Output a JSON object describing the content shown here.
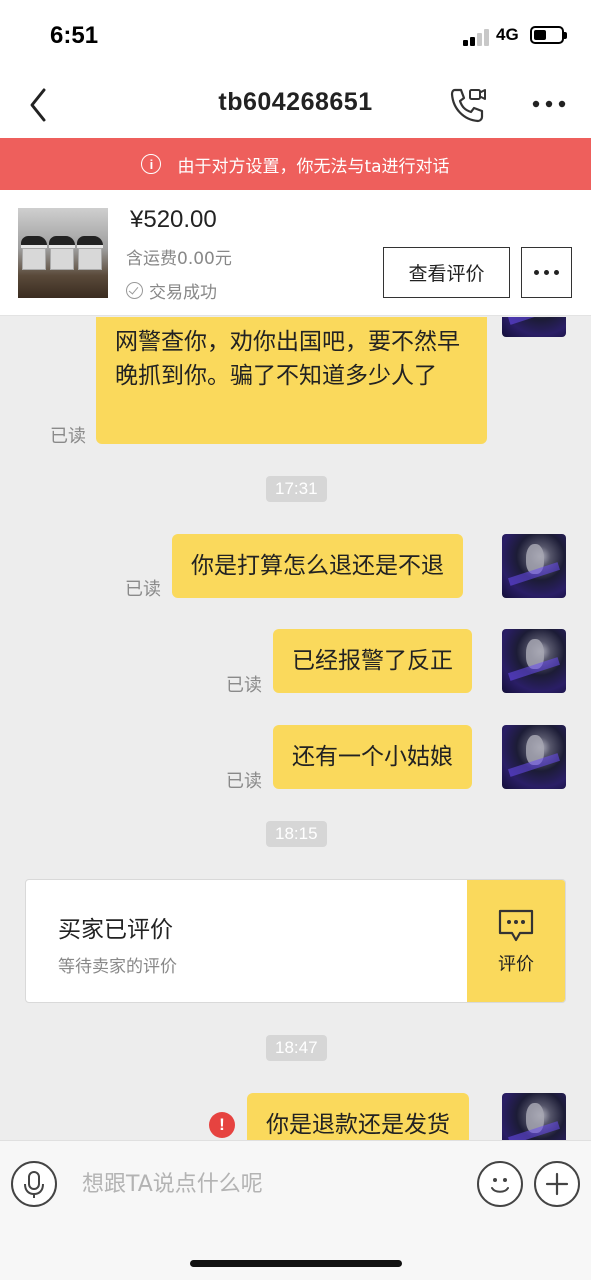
{
  "status_bar": {
    "time": "6:51",
    "network": "4G"
  },
  "nav": {
    "title": "tb604268651",
    "icons": {
      "back": "chevron-left-icon",
      "call": "phone-video-icon",
      "more": "more-dots-icon"
    }
  },
  "banner": {
    "icon": "info-icon",
    "text": "由于对方设置，你无法与ta进行对话"
  },
  "product": {
    "price": "¥520.00",
    "shipping": "含运费0.00元",
    "status": "交易成功",
    "review_button": "查看评价"
  },
  "messages": [
    {
      "text": "网警查你，劝你出国吧，要不然早晚抓到你。骗了不知道多少人了",
      "read": "已读"
    },
    {
      "text": "你是打算怎么退还是不退",
      "read": "已读"
    },
    {
      "text": "已经报警了反正",
      "read": "已读"
    },
    {
      "text": "还有一个小姑娘",
      "read": "已读"
    },
    {
      "text": "你是退款还是发货",
      "status": "failed"
    }
  ],
  "timestamps": [
    "17:31",
    "18:15",
    "18:47"
  ],
  "review_card": {
    "title": "买家已评价",
    "subtitle": "等待卖家的评价",
    "action": "评价",
    "action_icon": "comment-dots-icon"
  },
  "input": {
    "placeholder": "想跟TA说点什么呢"
  },
  "colors": {
    "bubble": "#fad95c",
    "banner": "#ee5f5c",
    "background": "#ededed",
    "error": "#e64340"
  }
}
